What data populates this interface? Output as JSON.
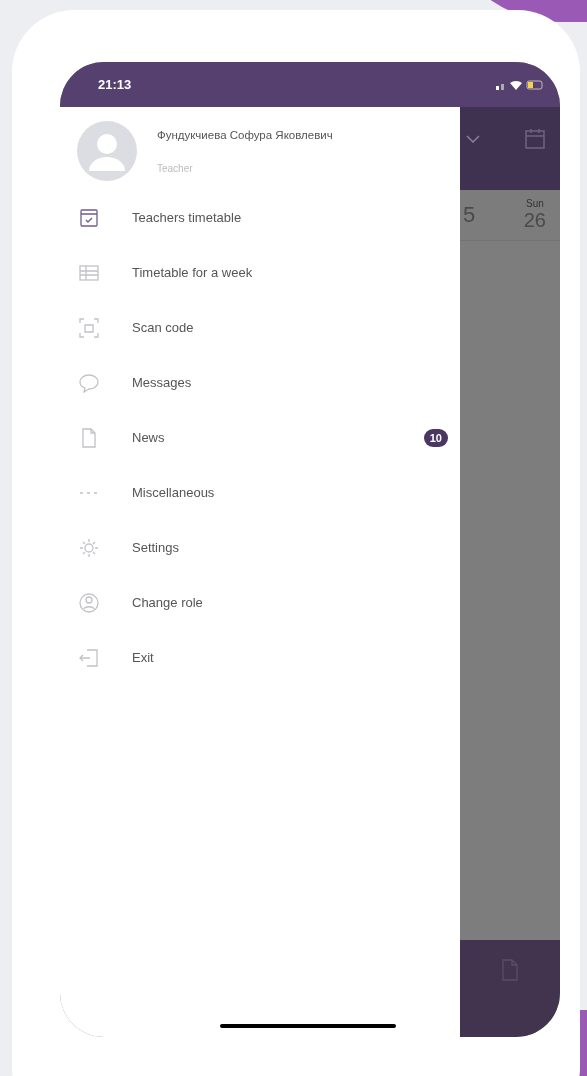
{
  "status_bar": {
    "time": "21:13"
  },
  "drawer": {
    "user": {
      "name": "Фундукчиева Софура Яковлевич",
      "role": "Teacher"
    },
    "items": [
      {
        "label": "Teachers timetable"
      },
      {
        "label": "Timetable for a week"
      },
      {
        "label": "Scan code"
      },
      {
        "label": "Messages"
      },
      {
        "label": "News",
        "badge": "10"
      },
      {
        "label": "Miscellaneous"
      },
      {
        "label": "Settings"
      },
      {
        "label": "Change role"
      },
      {
        "label": "Exit"
      }
    ]
  },
  "background_screen": {
    "partial_date": "5",
    "weekday": "Sun",
    "date": "26"
  }
}
